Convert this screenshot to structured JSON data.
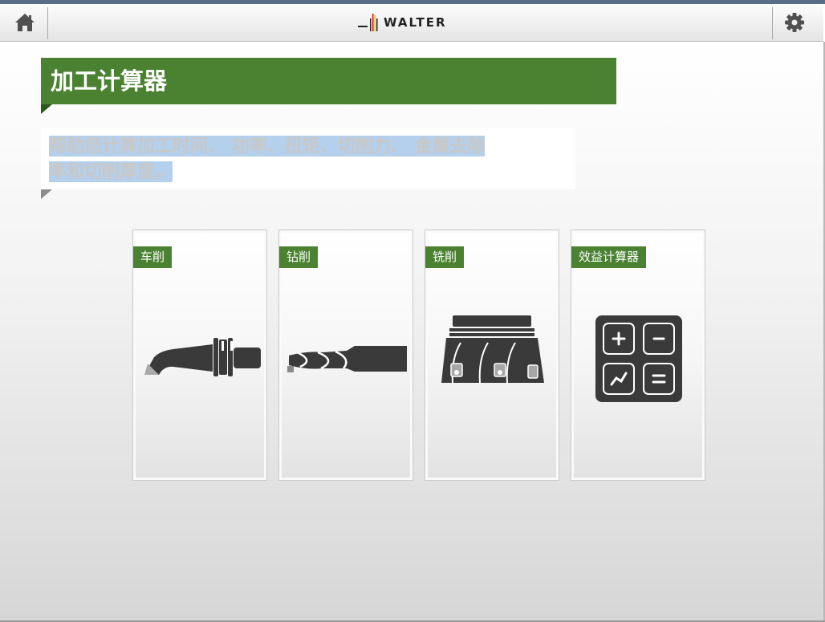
{
  "header": {
    "logo_text": "WALTER",
    "home_icon": "home-icon",
    "settings_icon": "gear-icon"
  },
  "page": {
    "title": "加工计算器",
    "description_line1": "帮助您计算加工时间、 功率、扭矩、切削力、 金属去除",
    "description_line2": "率和切削厚度。"
  },
  "cards": [
    {
      "label": "车削",
      "icon": "turning-tool-icon"
    },
    {
      "label": "钻削",
      "icon": "drill-icon"
    },
    {
      "label": "铣削",
      "icon": "milling-cutter-icon"
    },
    {
      "label": "效益计算器",
      "icon": "calculator-icon"
    }
  ],
  "calculator_keys": [
    "+",
    "-",
    "↗",
    "="
  ],
  "colors": {
    "accent_green": "#4a8231",
    "icon_dark": "#3a3a3a",
    "selection_blue": "#b5d0ec"
  }
}
